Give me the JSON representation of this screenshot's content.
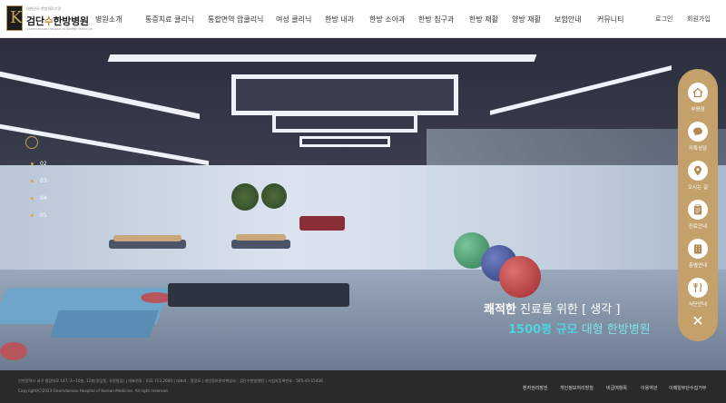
{
  "logo": {
    "small": "대한민국 한방의료기관",
    "name_a": "검단",
    "name_accent": "수",
    "name_b": "한방병원",
    "eng": "Geomdansoo Hospital of Korean Medicine"
  },
  "nav": {
    "items": [
      "병원소개",
      "통증치료 클리닉",
      "통합면역 암클리닉",
      "여성 클리닉",
      "한방 내과",
      "한방 소아과",
      "한방 침구과",
      "한방 재활",
      "양방 재활",
      "보험안내",
      "커뮤니티"
    ],
    "login": "로그인",
    "signup": "회원가입"
  },
  "slider": {
    "indicators": [
      "02",
      "03",
      "04",
      "05"
    ],
    "caption1_bold": "쾌적한",
    "caption1_rest": " 진료를 위한 [ 생각 ]",
    "caption2_hl": "1500평 규모",
    "caption2_rest": " 대형 한방병원"
  },
  "quick_menu": {
    "items": [
      {
        "icon": "home-icon",
        "label": "부평점"
      },
      {
        "icon": "chat-icon",
        "label": "카톡상담"
      },
      {
        "icon": "location-pin-icon",
        "label": "오시는 길"
      },
      {
        "icon": "clipboard-icon",
        "label": "진료안내"
      },
      {
        "icon": "building-icon",
        "label": "층별안내"
      },
      {
        "icon": "meal-icon",
        "label": "식단안내"
      }
    ],
    "close": "✕"
  },
  "footer": {
    "address": "인천광역시 서구 원당대로 147, 3~10층, 12층(원당동, 유원빌딩) | 대표전화 : 032.713.2000 | 대표자 : 정광모 | 개인정보관리책임자 : 검단수한방병원 | 사업자등록번호 : 505-40-15436",
    "copyright": "Copyright(C)2023 Geomdansoo Hospital of Korean Medicine. All right reserved.",
    "links": [
      "환자권리장전",
      "개인정보처리방침",
      "비급여항목",
      "이용약관",
      "이메일무단수집거부"
    ]
  },
  "colors": {
    "accent_gold": "#c4a06b",
    "caption_highlight": "#4fd3e0",
    "footer_bg": "#2a2a2a"
  }
}
